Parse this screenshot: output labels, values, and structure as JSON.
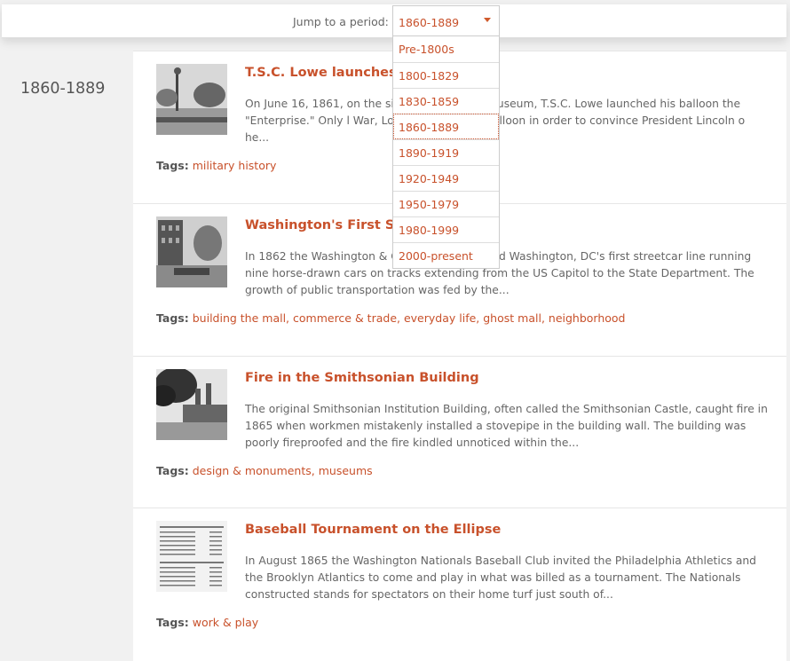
{
  "nav": {
    "jump_label": "Jump to a period:",
    "selected": "1860-1889",
    "options": [
      "Pre-1800s",
      "1800-1829",
      "1830-1859",
      "1860-1889",
      "1890-1919",
      "1920-1949",
      "1950-1979",
      "1980-1999",
      "2000-present"
    ]
  },
  "period_heading": "1860-1889",
  "tags_label": "Tags:",
  "articles": [
    {
      "title": "T.S.C. Lowe launches ba",
      "excerpt": "On June 16, 1861, on the site                              Air and Space Museum, T.S.C. Lowe launched his balloon the \"Enterprise.\" Only                            l War, Lowe launched his balloon in order to convince President Lincoln o                         he...",
      "tags": [
        "military history"
      ]
    },
    {
      "title": "Washington's First Stree",
      "excerpt": "In 1862 the Washington & Ge                              Company opened Washington, DC's first streetcar line running nine horse-drawn cars on tracks extending from the US Capitol to the State Department. The growth of public transportation was fed by the...",
      "tags": [
        "building the mall",
        "commerce & trade",
        "everyday life",
        "ghost mall",
        "neighborhood"
      ]
    },
    {
      "title": "Fire in the Smithsonian Building",
      "excerpt": "The original Smithsonian Institution Building, often called the Smithsonian Castle, caught fire in 1865 when workmen mistakenly installed a stovepipe in the building wall. The building was poorly fireproofed and the fire kindled unnoticed within the...",
      "tags": [
        "design & monuments",
        "museums"
      ]
    },
    {
      "title": "Baseball Tournament on the Ellipse",
      "excerpt": "In August 1865 the Washington Nationals Baseball Club invited the Philadelphia Athletics and the Brooklyn Atlantics to come and play in what was billed as a tournament. The Nationals constructed stands for spectators on their home turf just south of...",
      "tags": [
        "work & play"
      ]
    }
  ]
}
